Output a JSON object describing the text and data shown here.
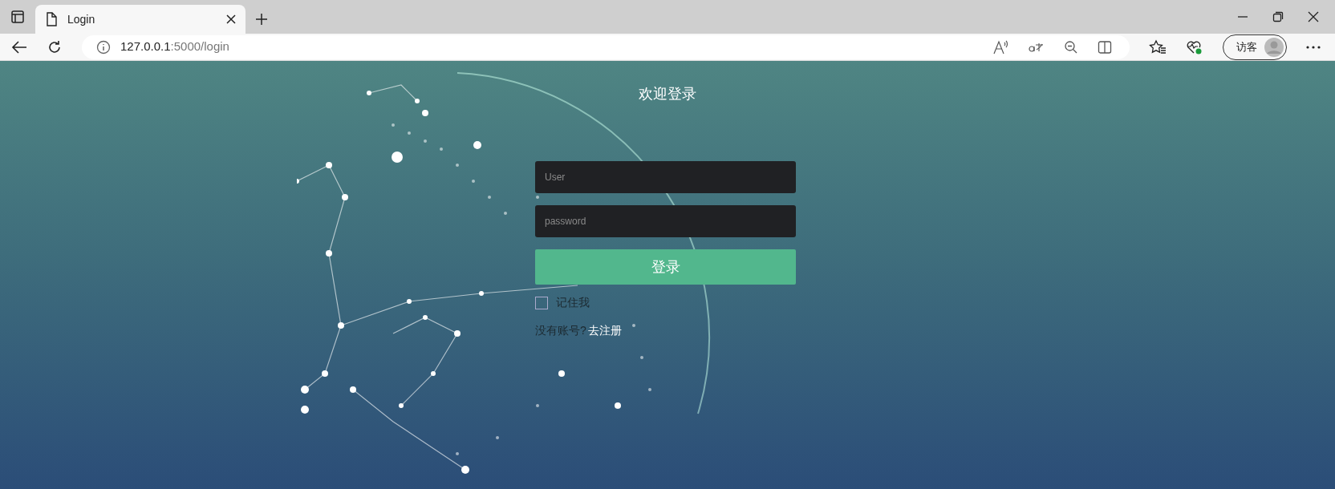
{
  "browser": {
    "tab": {
      "title": "Login",
      "selected": true
    },
    "address": {
      "host": "127.0.0.1",
      "path": ":5000/login"
    },
    "profile": {
      "label": "访客"
    }
  },
  "page": {
    "heading": "欢迎登录",
    "username_field": {
      "placeholder": "User"
    },
    "password_field": {
      "placeholder": "password"
    },
    "submit": "登录",
    "remember": {
      "label": "记住我",
      "checked": false
    },
    "register": {
      "prompt": "没有账号?",
      "link": "去注册"
    }
  }
}
